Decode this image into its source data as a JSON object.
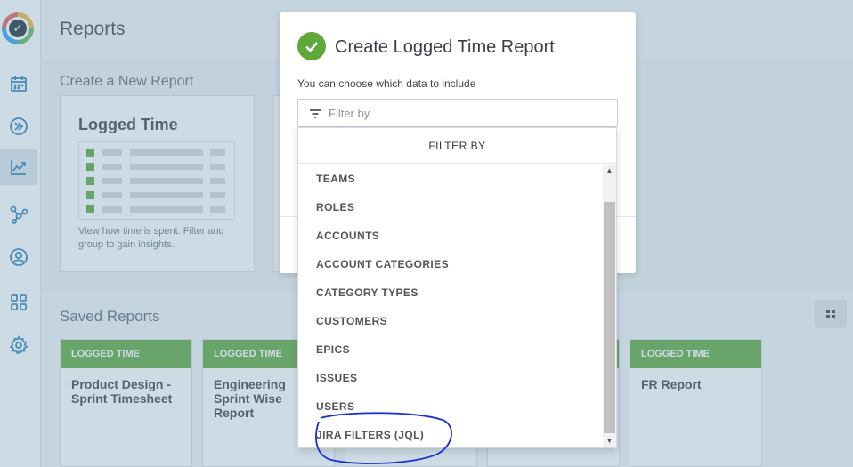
{
  "page": {
    "title": "Reports"
  },
  "create_section": {
    "title": "Create a New Report",
    "card": {
      "title": "Logged Time",
      "description": "View how time is spent. Filter and group to gain insights."
    }
  },
  "saved_section": {
    "title": "Saved Reports",
    "cards": [
      {
        "header": "LOGGED TIME",
        "name": "Product Design - Sprint Timesheet"
      },
      {
        "header": "LOGGED TIME",
        "name": "Engineering Sprint Wise Report"
      },
      {
        "header": "LOGGED TIME",
        "name": "FR Report"
      }
    ]
  },
  "modal": {
    "title": "Create Logged Time Report",
    "subtitle": "You can choose which data to include",
    "filter_placeholder": "Filter by"
  },
  "dropdown": {
    "header": "FILTER BY",
    "items": [
      "TEAMS",
      "ROLES",
      "ACCOUNTS",
      "ACCOUNT CATEGORIES",
      "CATEGORY TYPES",
      "CUSTOMERS",
      "EPICS",
      "ISSUES",
      "USERS",
      "JIRA FILTERS (JQL)"
    ]
  },
  "colors": {
    "accent_green": "#5fa83a",
    "annotation_blue": "#1a2fd6"
  },
  "sidebar": {
    "icons": [
      "calendar-icon",
      "chevrons-right-icon",
      "trend-chart-icon",
      "share-nodes-icon",
      "user-circle-icon",
      "apps-grid-icon",
      "gear-icon"
    ]
  }
}
